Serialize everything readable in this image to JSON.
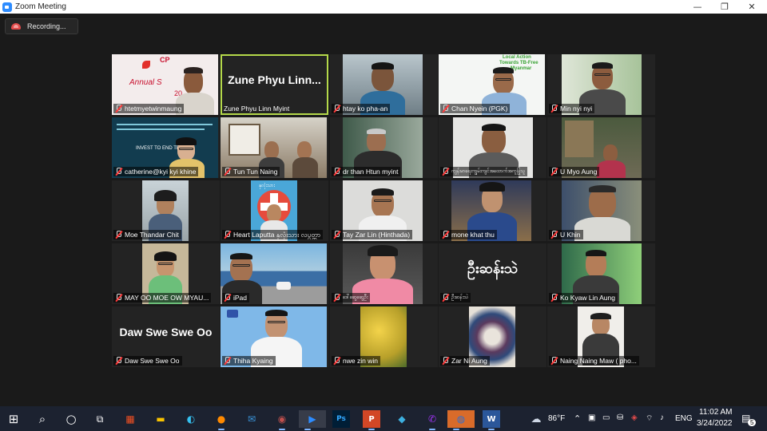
{
  "window": {
    "title": "Zoom Meeting",
    "minimize_glyph": "—",
    "restore_glyph": "❐",
    "close_glyph": "✕"
  },
  "recording": {
    "label": "Recording..."
  },
  "participants": [
    {
      "name": "htetmyetwinmaung",
      "muted": true,
      "overlay": [
        "CP",
        "Annual S",
        "20"
      ]
    },
    {
      "name": "Zune Phyu Linn Myint",
      "muted": false,
      "display_name": "Zune Phyu Linn..."
    },
    {
      "name": "htay ko pha-an",
      "muted": true
    },
    {
      "name": "Chan Nyein (PGK)",
      "muted": true,
      "overlay": [
        "Local Action",
        "Towards TB-Free",
        "Myanmar"
      ]
    },
    {
      "name": "Min nyi nyi",
      "muted": true
    },
    {
      "name": "catherine@kyi kyi khine",
      "muted": true,
      "overlay": [
        "INVEST TO END TB. S"
      ]
    },
    {
      "name": "Tun Tun Naing",
      "muted": true
    },
    {
      "name": "dr than Htun myint",
      "muted": true
    },
    {
      "name": "ကျန်းမာရေးကျွမ်းကျင်အထောက်အကူပြုသူ",
      "muted": true
    },
    {
      "name": "U Myo Aung",
      "muted": true
    },
    {
      "name": "Moe Thandar Chit",
      "muted": true
    },
    {
      "name": "Heart Laputta နှလုံးသား လပွတ္တာ",
      "muted": true,
      "overlay": [
        "နှလုံးသား"
      ]
    },
    {
      "name": "Tay Zar Lin (Hinthada)",
      "muted": true
    },
    {
      "name": "mone khat thu",
      "muted": true
    },
    {
      "name": "U Khin",
      "muted": true
    },
    {
      "name": "MAY OO MOE OW MYAU...",
      "muted": true
    },
    {
      "name": "iPad",
      "muted": true
    },
    {
      "name": "ဒေါ်ဆွေဆွေဦး",
      "muted": true
    },
    {
      "name": "ဦးဆန်းသဲ",
      "muted": true,
      "display_name": "ဦးဆန်းသဲ"
    },
    {
      "name": "Ko Kyaw Lin Aung",
      "muted": true
    },
    {
      "name": "Daw Swe Swe Oo",
      "muted": true,
      "display_name": "Daw Swe Swe Oo"
    },
    {
      "name": "Thiha Kyaing",
      "muted": true
    },
    {
      "name": "nwe zin win",
      "muted": true
    },
    {
      "name": "Zar Ni Aung",
      "muted": true
    },
    {
      "name": "Naing  Naing Maw ( pho...",
      "muted": true
    }
  ],
  "taskbar": {
    "start_glyph": "⊞",
    "search_glyph": "⌕",
    "cortana_glyph": "○",
    "taskview_glyph": "⧉",
    "apps": [
      {
        "name": "store",
        "glyph": "▦",
        "color": "#f25022"
      },
      {
        "name": "file-explorer",
        "glyph": "▬",
        "color": "#f8c300"
      },
      {
        "name": "edge",
        "glyph": "◐",
        "color": "#35c1f1"
      },
      {
        "name": "firefox",
        "glyph": "●",
        "color": "#ff8a00"
      },
      {
        "name": "mail",
        "glyph": "✉",
        "color": "#3a96dd"
      },
      {
        "name": "language",
        "glyph": "◉",
        "color": "#c0504d"
      },
      {
        "name": "zoom",
        "glyph": "▶",
        "color": "#2d8cff"
      },
      {
        "name": "photoshop",
        "glyph": "Ps",
        "color": "#31a8ff"
      },
      {
        "name": "powerpoint",
        "glyph": "P",
        "color": "#d24726"
      },
      {
        "name": "vpn",
        "glyph": "◆",
        "color": "#3db0e0"
      },
      {
        "name": "messenger",
        "glyph": "✆",
        "color": "#a334fa"
      },
      {
        "name": "browser",
        "glyph": "◍",
        "color": "#2f6fd1"
      },
      {
        "name": "word",
        "glyph": "W",
        "color": "#2b579a"
      }
    ],
    "weather": "86°F",
    "language": "ENG",
    "time": "11:02 AM",
    "date": "3/24/2022",
    "notification_count": "5"
  }
}
